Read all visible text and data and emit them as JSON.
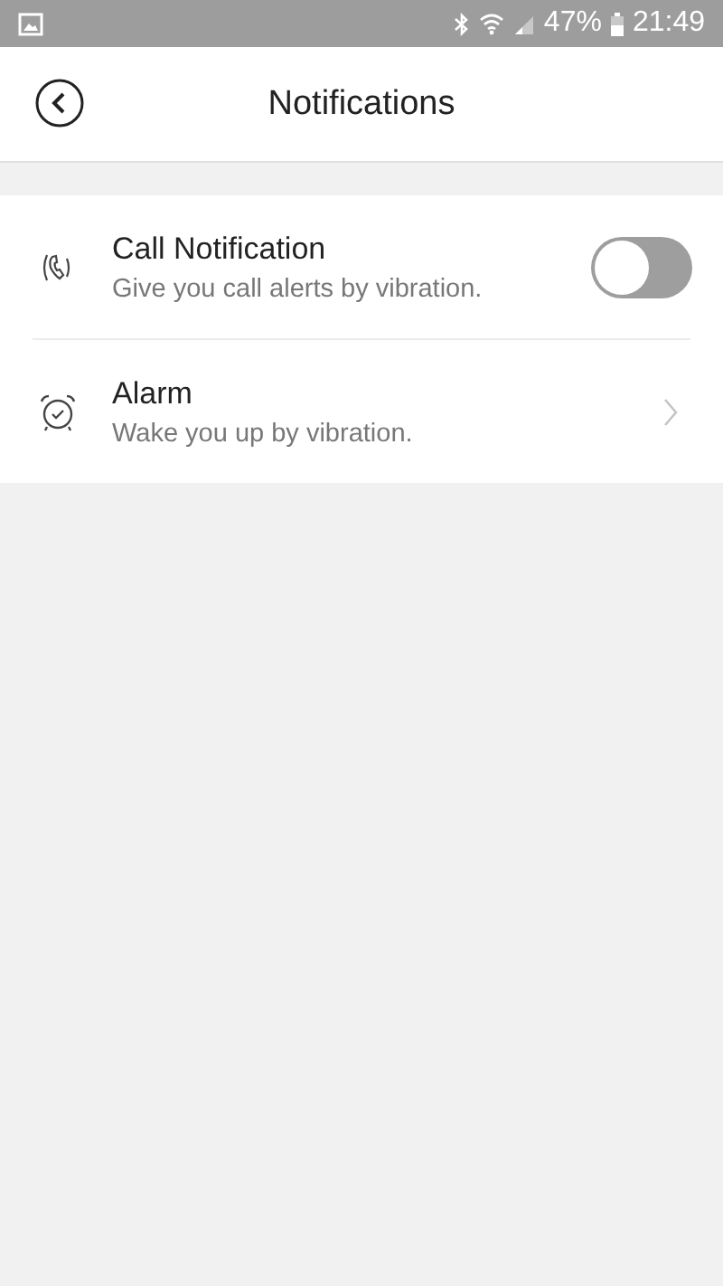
{
  "status_bar": {
    "battery": "47%",
    "time": "21:49"
  },
  "header": {
    "title": "Notifications"
  },
  "settings": [
    {
      "kind": "toggle",
      "title": "Call Notification",
      "subtitle": "Give you call alerts by vibration.",
      "on": false
    },
    {
      "kind": "link",
      "title": "Alarm",
      "subtitle": "Wake you up by vibration."
    }
  ]
}
